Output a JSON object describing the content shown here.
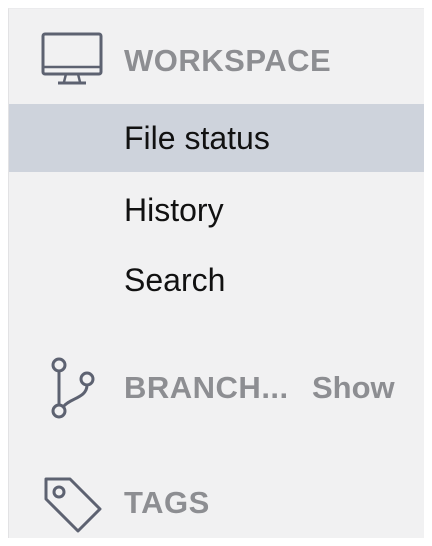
{
  "sidebar": {
    "workspace": {
      "icon": "monitor-icon",
      "label": "WORKSPACE",
      "items": [
        {
          "label": "File status",
          "selected": true
        },
        {
          "label": "History",
          "selected": false
        },
        {
          "label": "Search",
          "selected": false
        }
      ]
    },
    "branches": {
      "icon": "branch-icon",
      "label": "BRANCH...",
      "show_label": "Show"
    },
    "tags": {
      "icon": "tag-icon",
      "label": "TAGS"
    }
  },
  "colors": {
    "sidebar_bg": "#f1f1f2",
    "selected_bg": "#ced3dc",
    "header_text": "#8d8e92",
    "item_text": "#111111",
    "icon_color": "#5d6271"
  }
}
